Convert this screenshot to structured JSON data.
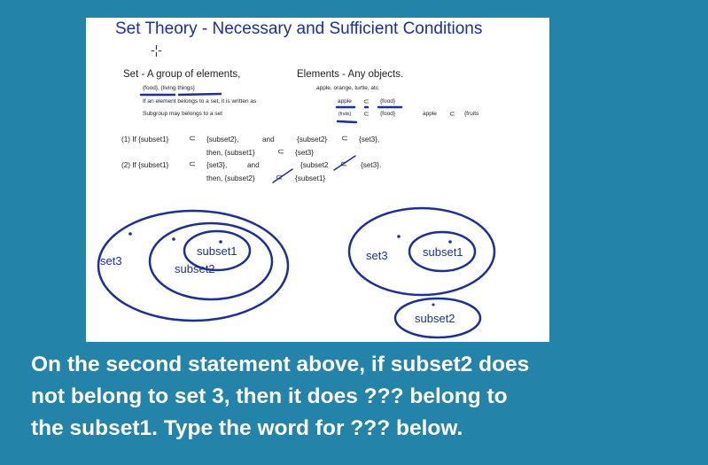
{
  "slide": {
    "title": "Set Theory - Necessary and Sufficient Conditions",
    "crosshair": "-¦-",
    "set_def": "Set - A group of elements,",
    "elements_def": "Elements - Any objects.",
    "set_examples": "{food}, {living things}",
    "element_examples": "apple, orange, turtle, atc",
    "belongs_text": "If an element belongs to a set, it is written as",
    "belongs_example_left": "apple",
    "belongs_example_right": "{food}",
    "subgroup_text": "Subgroup may belongs to a set",
    "subgroup_example_left": "{fruits}",
    "subgroup_example_right": "{food}",
    "subgroup_example2_left": "apple",
    "subgroup_example2_right": "{fruits",
    "rule1_line1_a": "(1) If {subset1}",
    "rule1_line1_b": "{subset2},",
    "rule1_line1_c": "and",
    "rule1_line1_d": "{subset2}",
    "rule1_line1_e": "{set3},",
    "rule1_line2_a": "then, {subset1}",
    "rule1_line2_b": "{set3}",
    "rule2_line1_a": "(2) If {subset1}",
    "rule2_line1_b": "{set3},",
    "rule2_line1_c": "and",
    "rule2_line1_d": "{subset2",
    "rule2_line1_e": "{set3}.",
    "rule2_line2_a": "then, {subset2}",
    "rule2_line2_b": "{subset1}",
    "subset_symbol": "⊂",
    "diagram_left": {
      "set3": "set3",
      "subset2": "subset2",
      "subset1": "subset1"
    },
    "diagram_right": {
      "set3": "set3",
      "subset1": "subset1",
      "subset2": "subset2"
    }
  },
  "question": {
    "line1": "On the second statement above, if subset2 does",
    "line2": "not belong to set 3, then it does ??? belong to",
    "line3": "the subset1. Type the word for ??? below."
  },
  "colors": {
    "background": "#2383a8",
    "ink_blue": "#1c2f9a",
    "slide_bg": "#ffffff",
    "question_text": "#ffffff"
  }
}
